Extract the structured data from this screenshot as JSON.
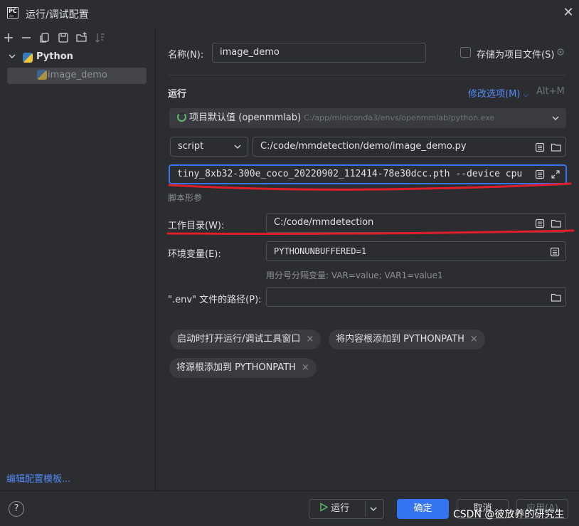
{
  "window": {
    "title": "运行/调试配置",
    "close_glyph": "✕"
  },
  "left_toolbar": {
    "icons": [
      "plus-icon",
      "minus-icon",
      "copy-icon",
      "save-icon",
      "new-folder-icon",
      "sort-icon"
    ]
  },
  "tree": {
    "group_label": "Python",
    "item_label": "image_demo"
  },
  "edit_templates_link": "编辑配置模板...",
  "form": {
    "name_label": "名称(N):",
    "name_value": "image_demo",
    "store_as_project_label": "存储为项目文件(S)",
    "run_section_label": "运行",
    "modify_options_label": "修改选项(M)",
    "modify_options_shortcut": "Alt+M",
    "interpreter_name": "项目默认值 (openmmlab)",
    "interpreter_path": "C:/app/miniconda3/envs/openmmlab/python.exe",
    "script_type": "script",
    "script_path": "C:/code/mmdetection/demo/image_demo.py",
    "script_params": "tiny_8xb32-300e_coco_20220902_112414-78e30dcc.pth --device cpu",
    "script_params_hint": "脚本形参",
    "workdir_label": "工作目录(W):",
    "workdir_value": "C:/code/mmdetection",
    "env_label": "环境变量(E):",
    "env_value": "PYTHONUNBUFFERED=1",
    "env_hint": "用分号分隔变量: VAR=value; VAR1=value1",
    "dotenv_label": "\".env\" 文件的路径(P):",
    "dotenv_value": ""
  },
  "chips": [
    "启动时打开运行/调试工具窗口",
    "将内容根添加到 PYTHONPATH",
    "将源根添加到 PYTHONPATH"
  ],
  "footer": {
    "help_glyph": "?",
    "run_label": "运行",
    "ok_label": "确定",
    "cancel_label": "取消",
    "apply_label": "应用(A)"
  },
  "watermark": "CSDN @彼放养的研究生",
  "colors": {
    "accent": "#3574f0",
    "link": "#548af7",
    "annotation_red": "#e01e2a"
  }
}
